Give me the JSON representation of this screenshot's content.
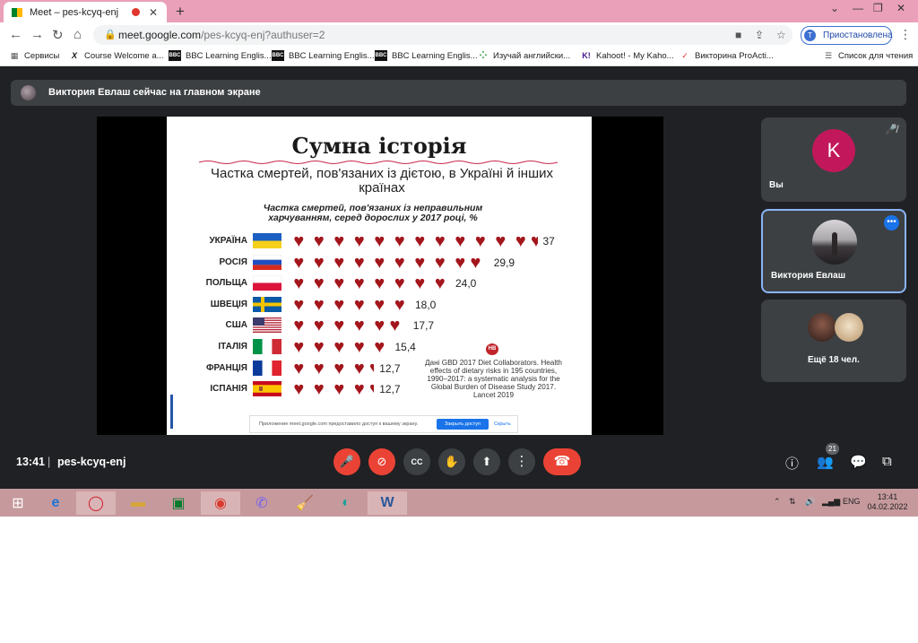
{
  "browser": {
    "tab_title": "Meet – pes-kcyq-enj",
    "tab_close": "✕",
    "new_tab": "+",
    "url_host": "meet.google.com",
    "url_path": "/pes-kcyq-enj?authuser=2",
    "profile_initial": "T",
    "profile_label": "Приостановлена",
    "window_controls": [
      "⌄",
      "—",
      "❐",
      "✕"
    ]
  },
  "bookmarks": [
    {
      "icon": "apps-grid-icon",
      "label": "Сервисы"
    },
    {
      "icon": "x-logo-icon",
      "label": "Course Welcome a..."
    },
    {
      "icon": "bbc-logo-icon",
      "label": "BBC Learning Englis..."
    },
    {
      "icon": "bbc-logo-icon",
      "label": "BBC Learning Englis..."
    },
    {
      "icon": "bbc-logo-icon",
      "label": "BBC Learning Englis..."
    },
    {
      "icon": "green-dots-icon",
      "label": "Изучай английски..."
    },
    {
      "icon": "kahoot-icon",
      "label": "Kahoot! - My Kaho..."
    },
    {
      "icon": "check-icon",
      "label": "Викторина ProActi..."
    },
    {
      "icon": "reading-list-icon",
      "label": "Список для чтения"
    }
  ],
  "meet": {
    "presenter_banner": "Виктория Евлаш сейчас на главном экране",
    "time": "13:41",
    "separator": "|",
    "meeting_code": "pes-kcyq-enj",
    "participants_count": "21",
    "tiles": [
      {
        "initial": "K",
        "name": "Вы",
        "color": "#c2185b"
      },
      {
        "name": "Виктория Евлаш"
      },
      {
        "name": "Ещё 18 чел."
      }
    ]
  },
  "slide": {
    "title": "Сумна історія",
    "subtitle": "Частка смертей, пов'язаних із дієтою, в Україні й інших країнах",
    "caption": "Частка смертей, пов'язаних із неправильним харчуванням, серед дорослих у 2017 році, %",
    "source": "Дані GBD 2017 Diet Collaborators. Health effects of dietary risks in 195 countries, 1990–2017: a systematic analysis for the Global Burden of Disease Study 2017. Lancet 2019",
    "source_badge": "НВ",
    "share_notice": "Приложение meet.google.com предоставило доступ к вашему экрану.",
    "share_stop": "Закрыть доступ",
    "share_hide": "Скрыть"
  },
  "chart_data": {
    "type": "bar",
    "categories": [
      "УКРАЇНА",
      "РОСІЯ",
      "ПОЛЬЩА",
      "ШВЕЦІЯ",
      "США",
      "ІТАЛІЯ",
      "ФРАНЦІЯ",
      "ІСПАНІЯ"
    ],
    "values": [
      37,
      29.9,
      24.0,
      18.0,
      17.7,
      15.4,
      12.7,
      12.7
    ],
    "value_labels": [
      "37",
      "29,9",
      "24,0",
      "18,0",
      "17,7",
      "15,4",
      "12,7",
      "12,7"
    ],
    "title": "Частка смертей, пов'язаних із неправильним харчуванням, серед дорослих у 2017 році, %",
    "xlabel": "",
    "ylabel": "",
    "mark": "heart",
    "heart_color": "#a3161c"
  },
  "taskbar": {
    "tray_lang": "ENG",
    "tray_time": "13:41",
    "tray_date": "04.02.2022",
    "tray_caret": "⌃"
  }
}
